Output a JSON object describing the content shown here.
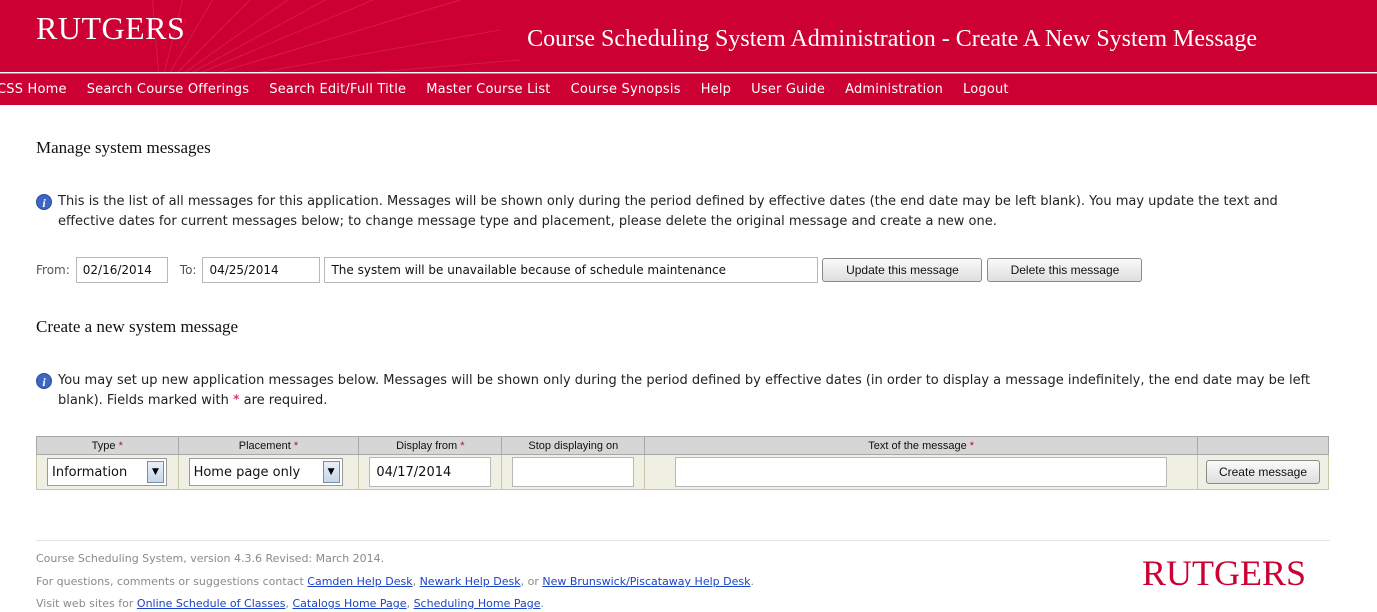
{
  "header": {
    "logo": "RUTGERS",
    "title": "Course Scheduling System Administration - Create A New System Message"
  },
  "nav": [
    "CSS Home",
    "Search Course Offerings",
    "Search Edit/Full Title",
    "Master Course List",
    "Course Synopsis",
    "Help",
    "User Guide",
    "Administration",
    "Logout"
  ],
  "manage": {
    "title": "Manage system messages",
    "info": "This is the list of all messages for this application. Messages will be shown only during the period defined by effective dates (the end date may be left blank). You may update the text and effective dates for current messages below; to change message type and placement, please delete the original message and create a new one.",
    "from_label": "From:",
    "from_value": "02/16/2014",
    "to_label": "To:",
    "to_value": "04/25/2014",
    "message_value": "The system will be unavailable because of schedule maintenance",
    "update_button": "Update this message",
    "delete_button": "Delete this message"
  },
  "create": {
    "title": "Create a new system message",
    "info_before": "You may set up new application messages below. Messages will be shown only during the period defined by effective dates (in order to display a message indefinitely, the end date may be left blank). Fields marked with ",
    "info_star": "*",
    "info_after": " are required.",
    "columns": [
      "Type",
      "Placement",
      "Display from",
      "Stop displaying on",
      "Text of the message",
      ""
    ],
    "required_mark": "*",
    "type_value": "Information",
    "placement_value": "Home page only",
    "display_from_value": "04/17/2014",
    "stop_value": "",
    "text_value": "",
    "create_button": "Create message"
  },
  "footer": {
    "version": "Course Scheduling System, version 4.3.6 Revised: March 2014.",
    "contact_prefix": "For questions, comments or suggestions contact ",
    "link_camden": "Camden Help Desk",
    "link_newark": "Newark Help Desk",
    "link_nb": "New Brunswick/Piscataway Help Desk",
    "sep_comma": ", ",
    "sep_or": ", or ",
    "period": ".",
    "visit_prefix": "Visit web sites for ",
    "link_schedule": "Online Schedule of Classes",
    "link_catalogs": "Catalogs Home Page",
    "link_sched_home": "Scheduling Home Page",
    "logo": "RUTGERS"
  },
  "colors": {
    "brand_red": "#cc0033",
    "info_icon": "#3c66c4",
    "link": "#1a44c8"
  }
}
